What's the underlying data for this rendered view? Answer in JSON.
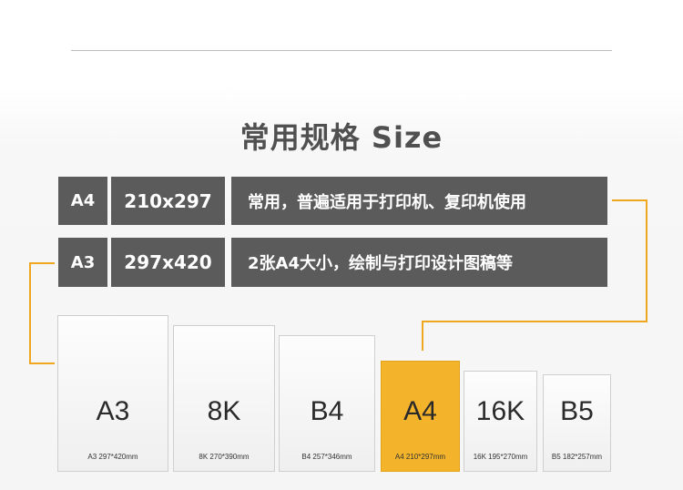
{
  "title": "常用规格 Size",
  "accent_color": "#f3b32a",
  "spec_rows": [
    {
      "code": "A4",
      "dimensions": "210x297",
      "description": "常用，普遍适用于打印机、复印机使用"
    },
    {
      "code": "A3",
      "dimensions": "297x420",
      "description": "2张A4大小，绘制与打印设计图稿等"
    }
  ],
  "sheets": [
    {
      "label": "A3",
      "dims": "A3  297*420mm",
      "highlighted": false
    },
    {
      "label": "8K",
      "dims": "8K 270*390mm",
      "highlighted": false
    },
    {
      "label": "B4",
      "dims": "B4  257*346mm",
      "highlighted": false
    },
    {
      "label": "A4",
      "dims": "A4  210*297mm",
      "highlighted": true
    },
    {
      "label": "16K",
      "dims": "16K 195*270mm",
      "highlighted": false
    },
    {
      "label": "B5",
      "dims": "B5  182*257mm",
      "highlighted": false
    }
  ]
}
